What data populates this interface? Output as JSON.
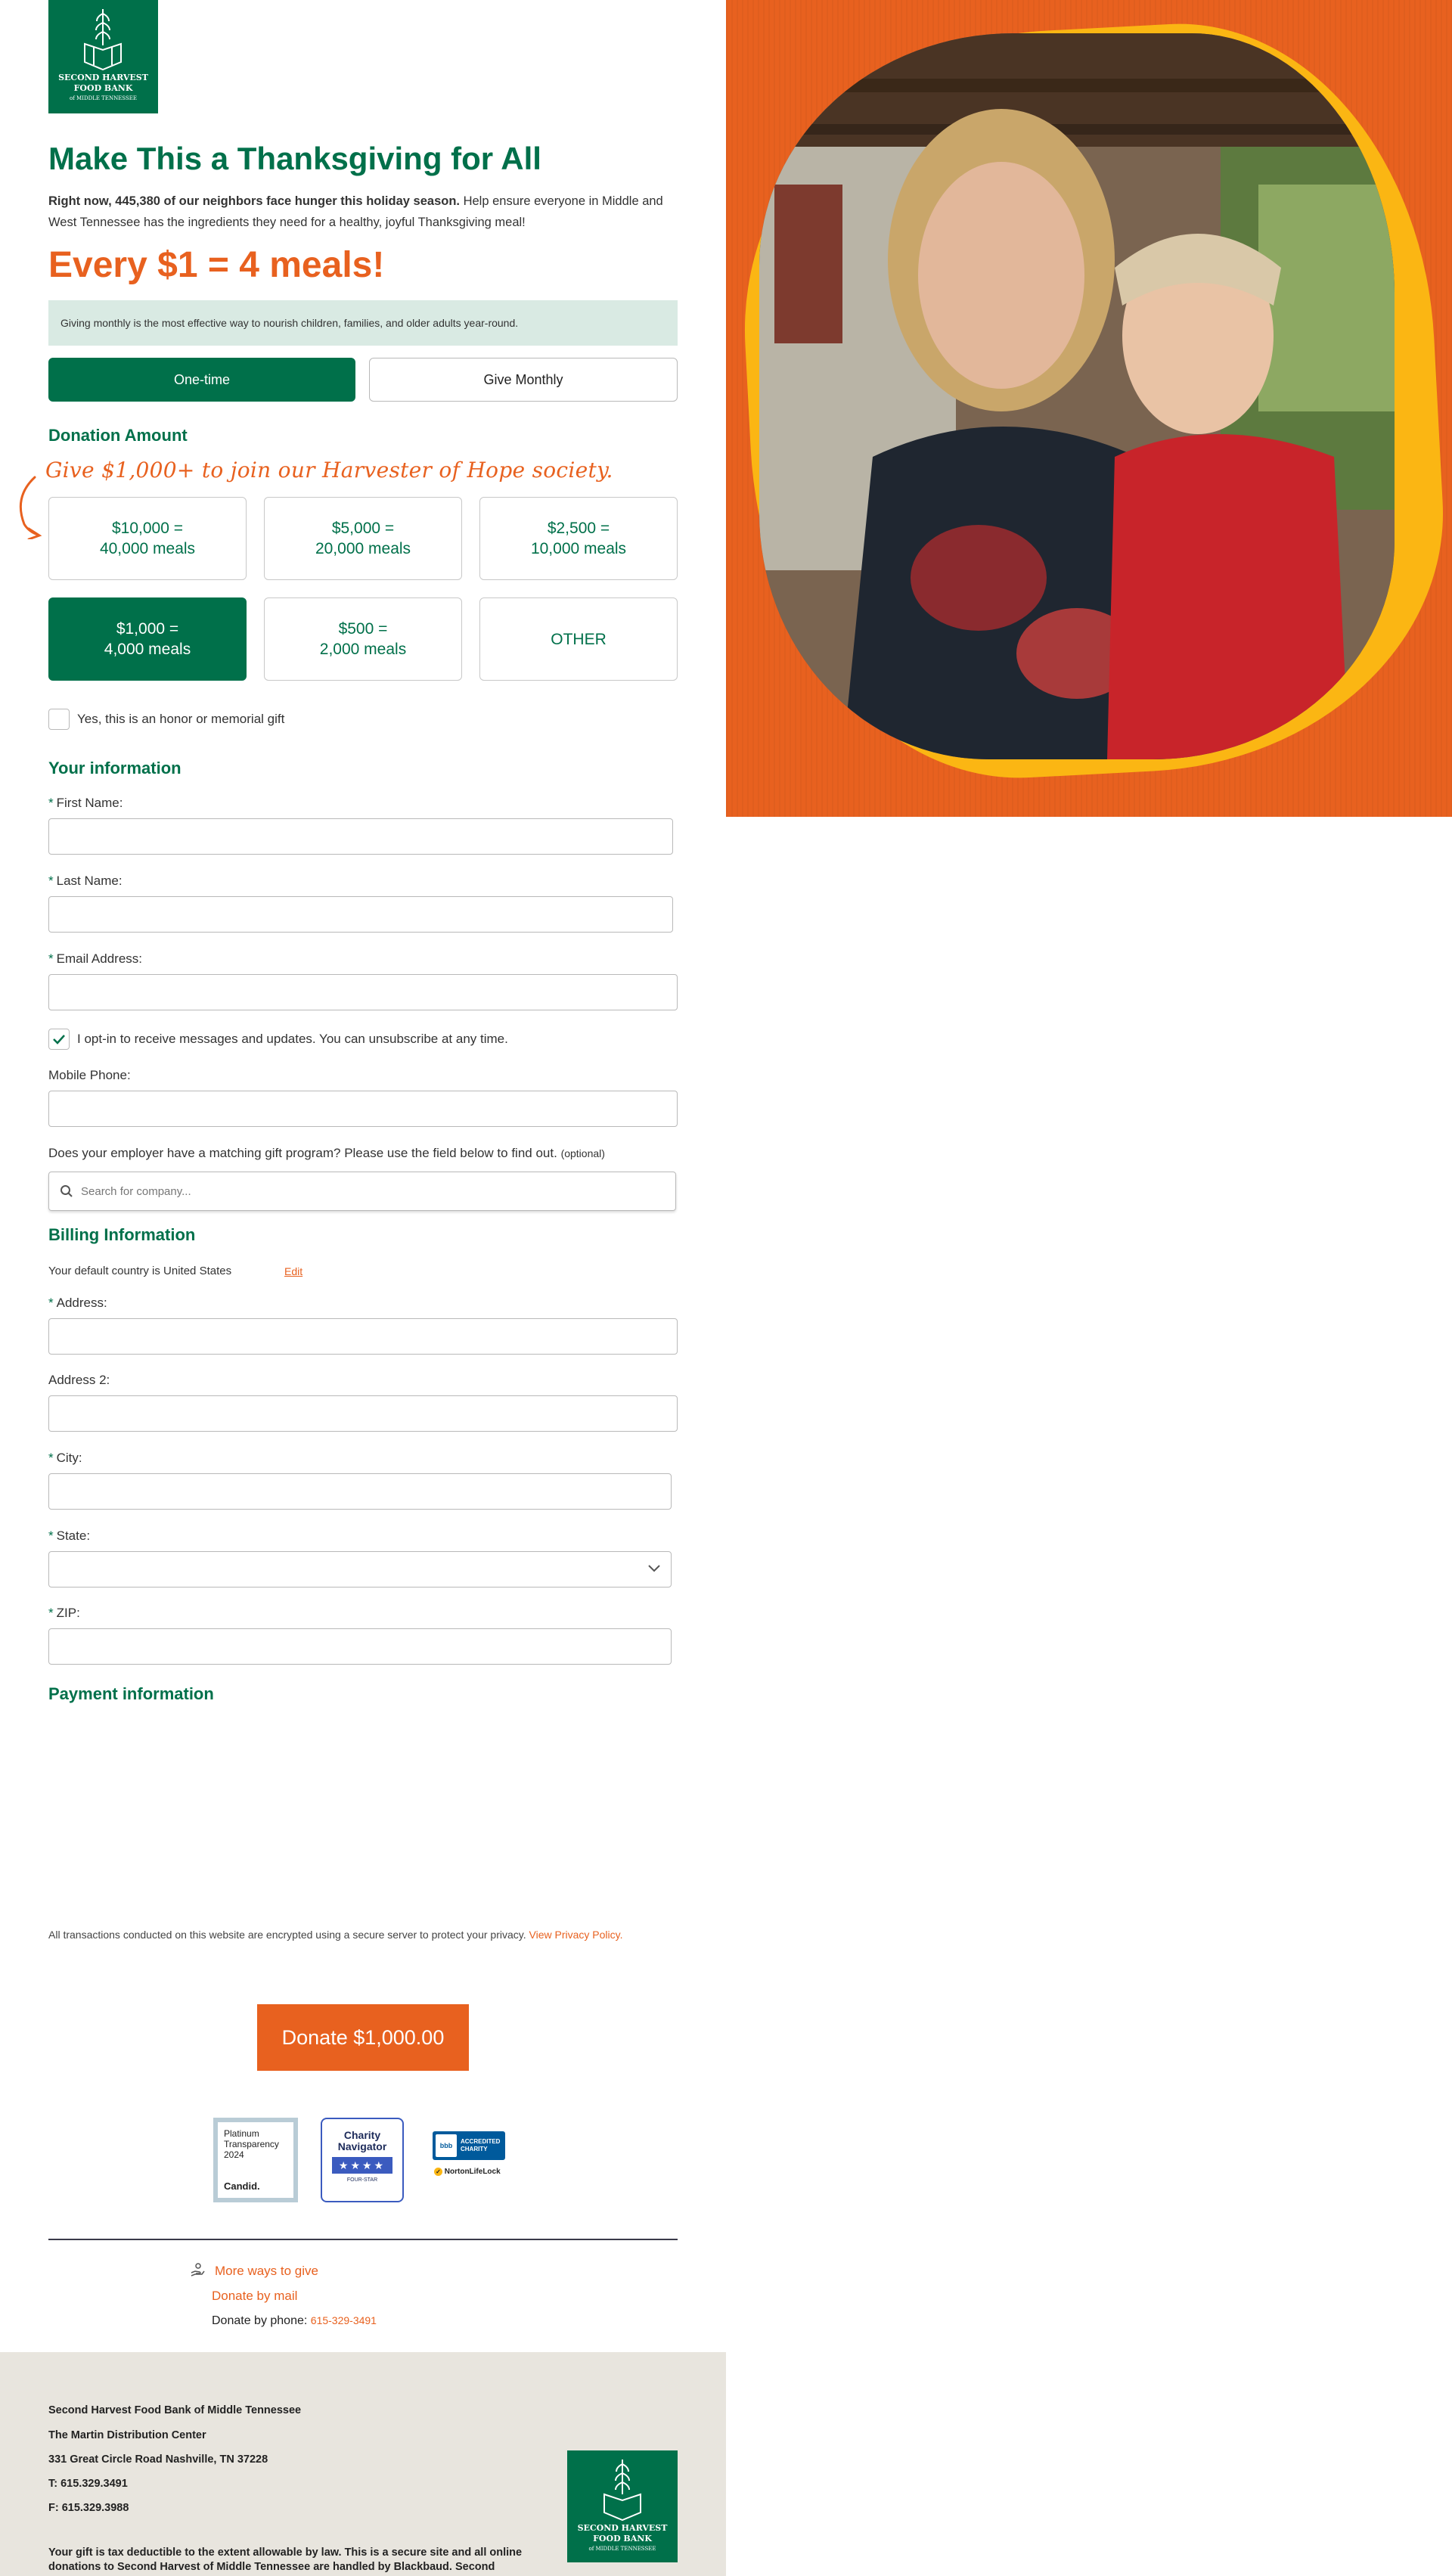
{
  "logo": {
    "line1": "SECOND HARVEST",
    "line2": "FOOD BANK",
    "line3": "of MIDDLE TENNESSEE"
  },
  "page": {
    "title": "Make This a Thanksgiving for All",
    "intro_bold": "Right now, 445,380 of our neighbors face hunger this holiday season.",
    "intro_rest": " Help ensure everyone in Middle and West Tennessee has the ingredients they need for a healthy, joyful Thanksgiving meal!",
    "headline": "Every $1 = 4 meals!",
    "notice": "Giving monthly is the most effective way to nourish children, families, and older adults year-round."
  },
  "frequency": {
    "one_time": "One-time",
    "monthly": "Give Monthly",
    "selected": "One-time"
  },
  "donation": {
    "heading": "Donation Amount",
    "society_text": "Give $1,000+ to join our Harvester of Hope society.",
    "amounts": [
      {
        "line1": "$10,000 =",
        "line2": "40,000 meals"
      },
      {
        "line1": "$5,000 =",
        "line2": "20,000 meals"
      },
      {
        "line1": "$2,500 =",
        "line2": "10,000 meals"
      },
      {
        "line1": "$1,000 =",
        "line2": "4,000 meals"
      },
      {
        "line1": "$500 =",
        "line2": "2,000 meals"
      },
      {
        "line1": "OTHER",
        "line2": ""
      }
    ],
    "selected_amount": "$1,000",
    "honor_label": "Yes, this is an honor or memorial gift"
  },
  "your_info": {
    "heading": "Your information",
    "first_name": "First Name:",
    "last_name": "Last Name:",
    "email": "Email Address:",
    "opt_in": "I opt-in to receive messages and updates. You can unsubscribe at any time.",
    "mobile": "Mobile Phone:",
    "employer_question": "Does your employer have a matching gift program? Please use the field below to find out.",
    "optional": "(optional)",
    "search_placeholder": "Search for company..."
  },
  "billing": {
    "heading": "Billing Information",
    "country_text": "Your default country is United States",
    "edit": "Edit",
    "address": "Address:",
    "address2": "Address 2:",
    "city": "City:",
    "state": "State:",
    "zip": "ZIP:"
  },
  "payment": {
    "heading": "Payment information"
  },
  "privacy": {
    "text": "All transactions conducted on this website are encrypted using a secure server to protect your privacy.",
    "link": "View Privacy Policy."
  },
  "donate_button": "Donate $1,000.00",
  "badges": {
    "candid": {
      "line1": "Platinum",
      "line2": "Transparency",
      "line3": "2024",
      "brand": "Candid."
    },
    "charity_navigator": {
      "line1": "Charity",
      "line2": "Navigator",
      "stars": "★★★★",
      "tagline": "FOUR-STAR"
    },
    "bbb": {
      "line1": "ACCREDITED",
      "line2": "CHARITY",
      "norton": "NortonLifeLock"
    }
  },
  "more_ways": {
    "heading": "More ways to give",
    "mail": "Donate by mail",
    "phone_label": "Donate by phone:",
    "phone": "615-329-3491"
  },
  "footer": {
    "org": "Second Harvest Food Bank of Middle Tennessee",
    "center": "The Martin Distribution Center",
    "address": "331 Great Circle Road Nashville, TN 37228",
    "phone": "T: 615.329.3491",
    "fax": "F: 615.329.3988",
    "disclaimer": "Your gift is tax deductible to the extent allowable by law. This is a secure site and all online donations to Second Harvest of Middle Tennessee are handled by Blackbaud. Second"
  },
  "colors": {
    "brand_green": "#00704a",
    "brand_orange": "#e8611f",
    "yellow": "#fbb613",
    "notice_bg": "#d9eae3",
    "footer_bg": "#e8e5de"
  }
}
